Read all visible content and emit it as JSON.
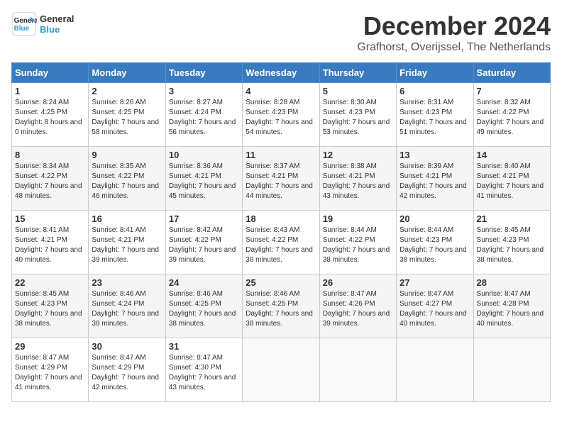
{
  "header": {
    "logo_line1": "General",
    "logo_line2": "Blue",
    "month": "December 2024",
    "location": "Grafhorst, Overijssel, The Netherlands"
  },
  "columns": [
    "Sunday",
    "Monday",
    "Tuesday",
    "Wednesday",
    "Thursday",
    "Friday",
    "Saturday"
  ],
  "weeks": [
    [
      {
        "day": "1",
        "sunrise": "8:24 AM",
        "sunset": "4:25 PM",
        "daylight": "8 hours and 0 minutes."
      },
      {
        "day": "2",
        "sunrise": "8:26 AM",
        "sunset": "4:25 PM",
        "daylight": "7 hours and 58 minutes."
      },
      {
        "day": "3",
        "sunrise": "8:27 AM",
        "sunset": "4:24 PM",
        "daylight": "7 hours and 56 minutes."
      },
      {
        "day": "4",
        "sunrise": "8:28 AM",
        "sunset": "4:23 PM",
        "daylight": "7 hours and 54 minutes."
      },
      {
        "day": "5",
        "sunrise": "8:30 AM",
        "sunset": "4:23 PM",
        "daylight": "7 hours and 53 minutes."
      },
      {
        "day": "6",
        "sunrise": "8:31 AM",
        "sunset": "4:23 PM",
        "daylight": "7 hours and 51 minutes."
      },
      {
        "day": "7",
        "sunrise": "8:32 AM",
        "sunset": "4:22 PM",
        "daylight": "7 hours and 49 minutes."
      }
    ],
    [
      {
        "day": "8",
        "sunrise": "8:34 AM",
        "sunset": "4:22 PM",
        "daylight": "7 hours and 48 minutes."
      },
      {
        "day": "9",
        "sunrise": "8:35 AM",
        "sunset": "4:22 PM",
        "daylight": "7 hours and 46 minutes."
      },
      {
        "day": "10",
        "sunrise": "8:36 AM",
        "sunset": "4:21 PM",
        "daylight": "7 hours and 45 minutes."
      },
      {
        "day": "11",
        "sunrise": "8:37 AM",
        "sunset": "4:21 PM",
        "daylight": "7 hours and 44 minutes."
      },
      {
        "day": "12",
        "sunrise": "8:38 AM",
        "sunset": "4:21 PM",
        "daylight": "7 hours and 43 minutes."
      },
      {
        "day": "13",
        "sunrise": "8:39 AM",
        "sunset": "4:21 PM",
        "daylight": "7 hours and 42 minutes."
      },
      {
        "day": "14",
        "sunrise": "8:40 AM",
        "sunset": "4:21 PM",
        "daylight": "7 hours and 41 minutes."
      }
    ],
    [
      {
        "day": "15",
        "sunrise": "8:41 AM",
        "sunset": "4:21 PM",
        "daylight": "7 hours and 40 minutes."
      },
      {
        "day": "16",
        "sunrise": "8:41 AM",
        "sunset": "4:21 PM",
        "daylight": "7 hours and 39 minutes."
      },
      {
        "day": "17",
        "sunrise": "8:42 AM",
        "sunset": "4:22 PM",
        "daylight": "7 hours and 39 minutes."
      },
      {
        "day": "18",
        "sunrise": "8:43 AM",
        "sunset": "4:22 PM",
        "daylight": "7 hours and 38 minutes."
      },
      {
        "day": "19",
        "sunrise": "8:44 AM",
        "sunset": "4:22 PM",
        "daylight": "7 hours and 38 minutes."
      },
      {
        "day": "20",
        "sunrise": "8:44 AM",
        "sunset": "4:23 PM",
        "daylight": "7 hours and 38 minutes."
      },
      {
        "day": "21",
        "sunrise": "8:45 AM",
        "sunset": "4:23 PM",
        "daylight": "7 hours and 38 minutes."
      }
    ],
    [
      {
        "day": "22",
        "sunrise": "8:45 AM",
        "sunset": "4:23 PM",
        "daylight": "7 hours and 38 minutes."
      },
      {
        "day": "23",
        "sunrise": "8:46 AM",
        "sunset": "4:24 PM",
        "daylight": "7 hours and 38 minutes."
      },
      {
        "day": "24",
        "sunrise": "8:46 AM",
        "sunset": "4:25 PM",
        "daylight": "7 hours and 38 minutes."
      },
      {
        "day": "25",
        "sunrise": "8:46 AM",
        "sunset": "4:25 PM",
        "daylight": "7 hours and 38 minutes."
      },
      {
        "day": "26",
        "sunrise": "8:47 AM",
        "sunset": "4:26 PM",
        "daylight": "7 hours and 39 minutes."
      },
      {
        "day": "27",
        "sunrise": "8:47 AM",
        "sunset": "4:27 PM",
        "daylight": "7 hours and 40 minutes."
      },
      {
        "day": "28",
        "sunrise": "8:47 AM",
        "sunset": "4:28 PM",
        "daylight": "7 hours and 40 minutes."
      }
    ],
    [
      {
        "day": "29",
        "sunrise": "8:47 AM",
        "sunset": "4:29 PM",
        "daylight": "7 hours and 41 minutes."
      },
      {
        "day": "30",
        "sunrise": "8:47 AM",
        "sunset": "4:29 PM",
        "daylight": "7 hours and 42 minutes."
      },
      {
        "day": "31",
        "sunrise": "8:47 AM",
        "sunset": "4:30 PM",
        "daylight": "7 hours and 43 minutes."
      },
      null,
      null,
      null,
      null
    ]
  ]
}
